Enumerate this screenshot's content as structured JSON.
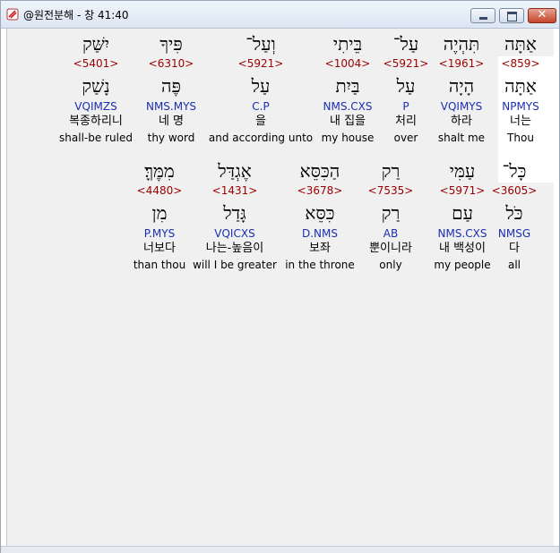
{
  "window": {
    "title": "@원전분해 - 창 41:40"
  },
  "rows": [
    [
      {
        "hebrew": "אַתָּה",
        "strong": "<859>",
        "lexeme": "אַתָּה",
        "parse": "NPMYS",
        "korean": "너는",
        "english": "Thou"
      },
      {
        "hebrew": "תִּהְיֶה",
        "strong": "<1961>",
        "lexeme": "הָיָה",
        "parse": "VQIMYS",
        "korean": "하라",
        "english": "shalt me"
      },
      {
        "hebrew": "עַל־",
        "strong": "<5921>",
        "lexeme": "עַל",
        "parse": "P",
        "korean": "처리",
        "english": "over"
      },
      {
        "hebrew": "בֵּיתִי",
        "strong": "<1004>",
        "lexeme": "בַּיִת",
        "parse": "NMS.CXS",
        "korean": "내 집을",
        "english": "my house"
      },
      {
        "hebrew": "וְעַל־",
        "strong": "<5921>",
        "lexeme": "עַל",
        "parse": "C.P",
        "korean": "을",
        "english": "and according unto"
      },
      {
        "hebrew": "פִּיךָ",
        "strong": "<6310>",
        "lexeme": "פֶּה",
        "parse": "NMS.MYS",
        "korean": "네 명",
        "english": "thy word"
      },
      {
        "hebrew": "יִשַּׁק",
        "strong": "<5401>",
        "lexeme": "נָשַׁק",
        "parse": "VQIMZS",
        "korean": "복종하리니",
        "english": "shall-be ruled"
      }
    ],
    [
      {
        "hebrew": "כָּל־",
        "strong": "<3605>",
        "lexeme": "כֹּל",
        "parse": "NMSG",
        "korean": "다",
        "english": "all"
      },
      {
        "hebrew": "עַמִּי",
        "strong": "<5971>",
        "lexeme": "עַם",
        "parse": "NMS.CXS",
        "korean": "내 백성이",
        "english": "my people"
      },
      {
        "hebrew": "רַק",
        "strong": "<7535>",
        "lexeme": "רַק",
        "parse": "AB",
        "korean": "뿐이니라",
        "english": "only"
      },
      {
        "hebrew": "הַכִּסֵּא",
        "strong": "<3678>",
        "lexeme": "כִּסֵּא",
        "parse": "D.NMS",
        "korean": "보좌",
        "english": "in the throne"
      },
      {
        "hebrew": "אֶגְדַּל",
        "strong": "<1431>",
        "lexeme": "גָּדַל",
        "parse": "VQICXS",
        "korean": "나는-높음이",
        "english": "will I be greater"
      },
      {
        "hebrew": "מִמֶּךָּ׃",
        "strong": "<4480>",
        "lexeme": "מִן",
        "parse": "P.MYS",
        "korean": "너보다",
        "english": "than thou"
      }
    ]
  ],
  "colors": {
    "strong": "#9b0000",
    "parse": "#1a2fb0",
    "highlight": "#ffffff"
  }
}
